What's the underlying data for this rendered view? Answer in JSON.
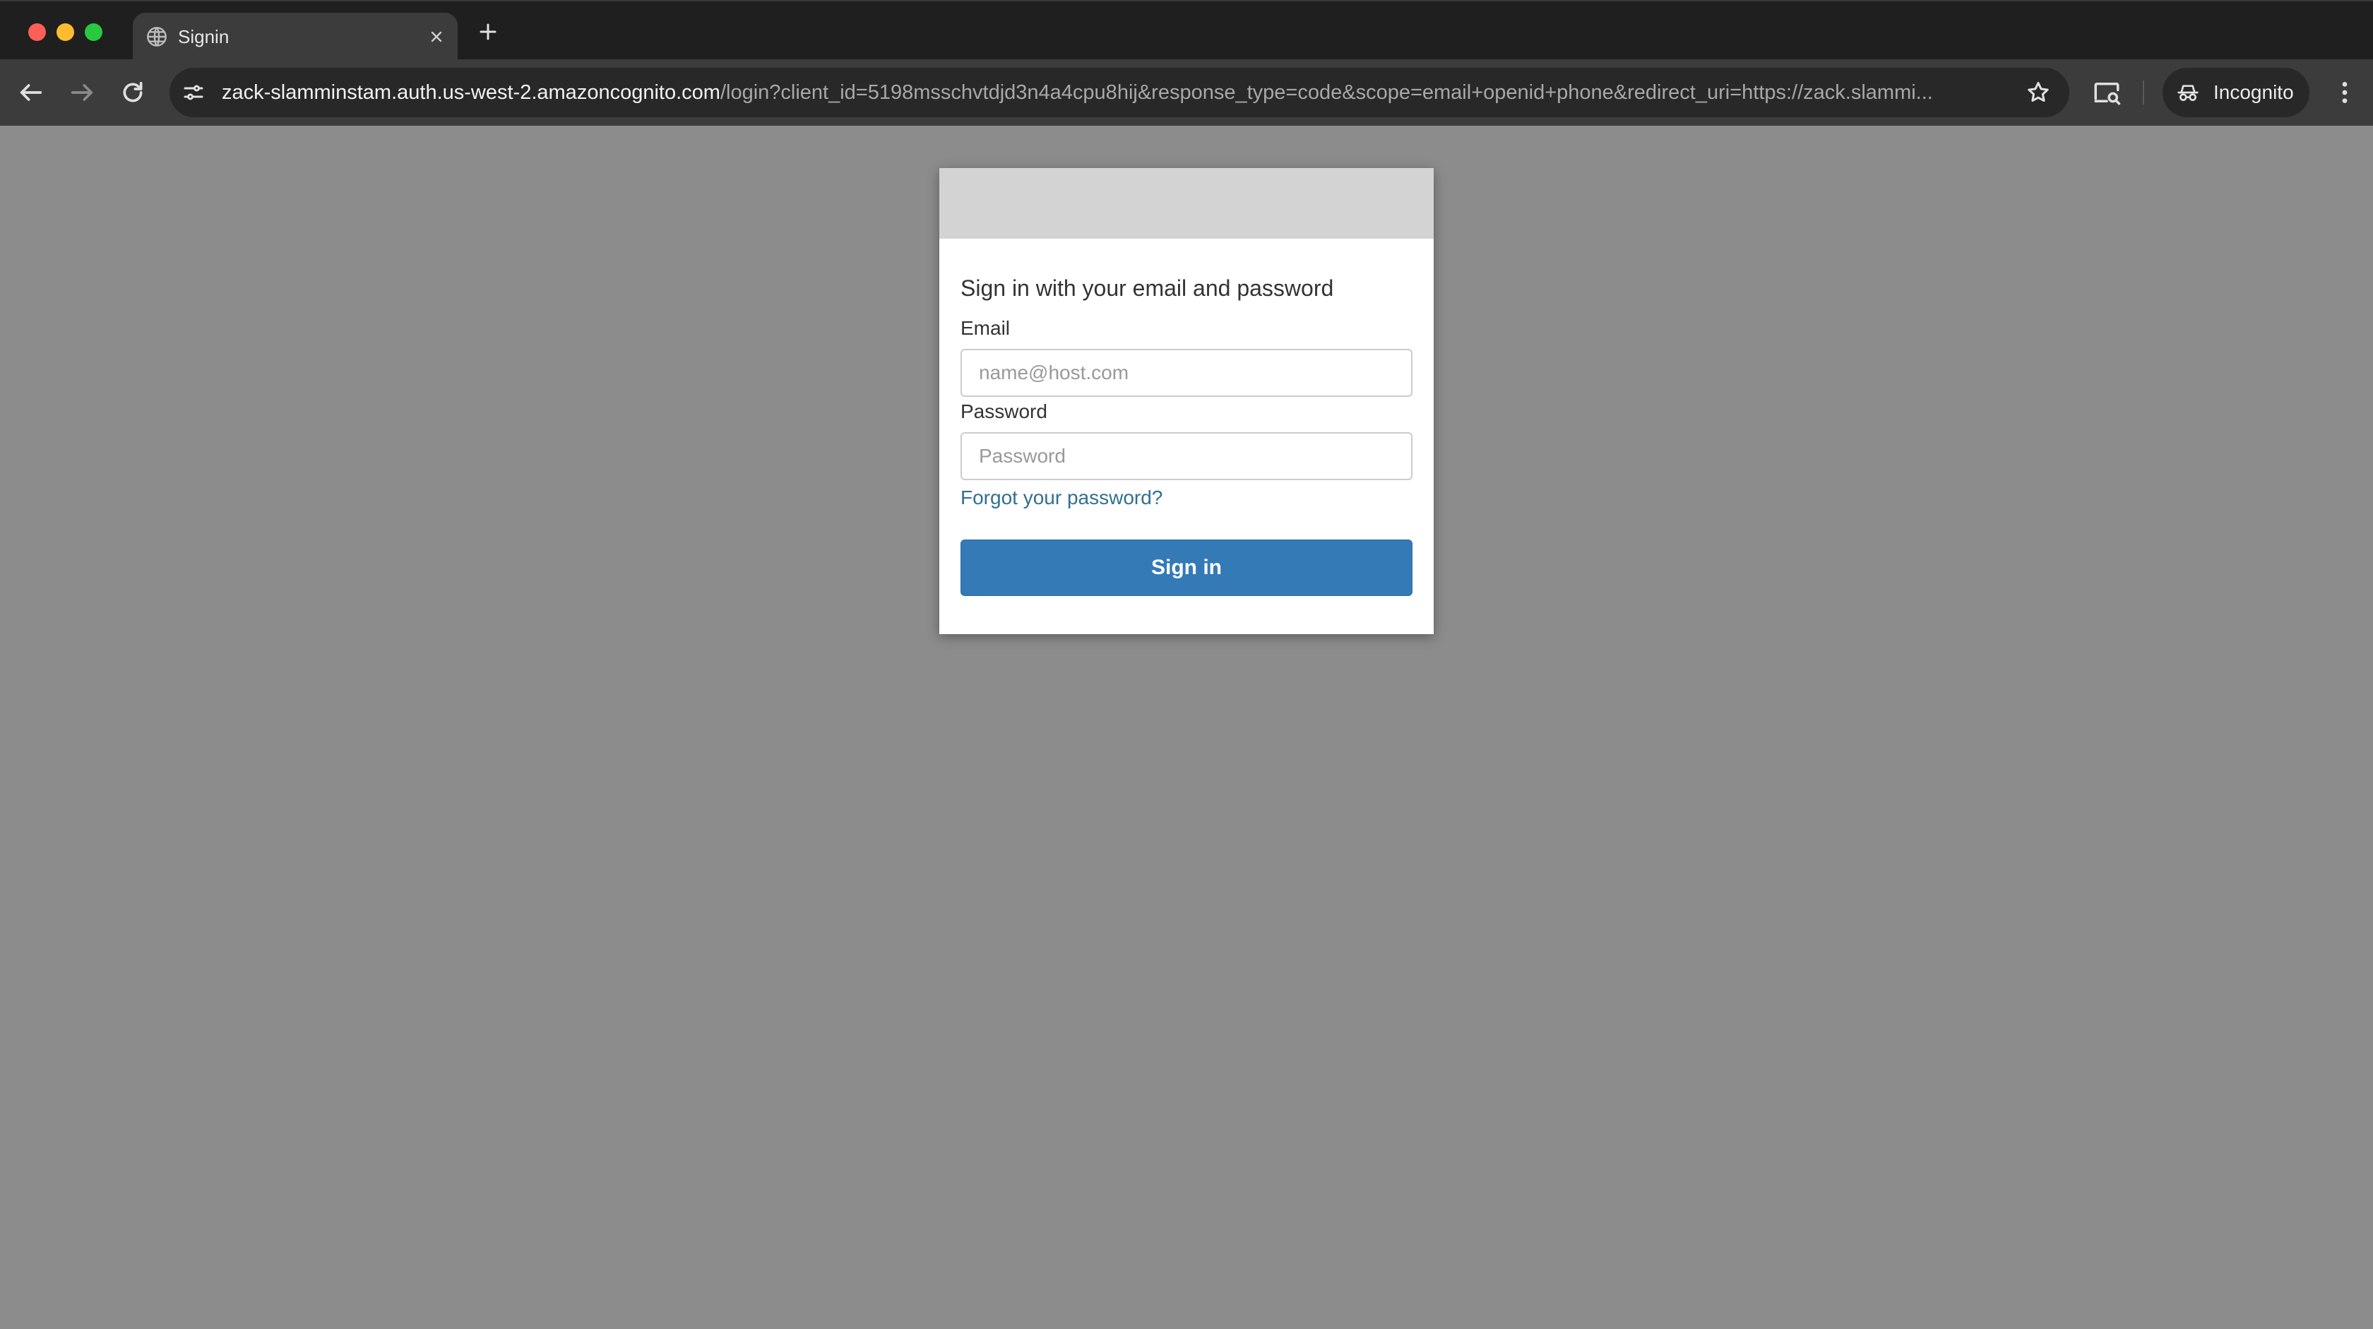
{
  "browser": {
    "tab": {
      "title": "Signin"
    },
    "address_bar": {
      "host": "zack-slamminstam.auth.us-west-2.amazoncognito.com",
      "path": "/login?client_id=5198msschvtdjd3n4a4cpu8hij&response_type=code&scope=email+openid+phone&redirect_uri=https://zack.slammi..."
    },
    "profile": {
      "label": "Incognito"
    },
    "icons": {
      "back": "arrow-left-icon",
      "forward": "arrow-right-icon",
      "reload": "reload-icon",
      "site_info": "tune-icon",
      "bookmark": "star-icon",
      "cast": "cast-icon",
      "incognito": "incognito-icon",
      "menu": "more-vertical-icon"
    }
  },
  "login": {
    "heading": "Sign in with your email and password",
    "email": {
      "label": "Email",
      "placeholder": "name@host.com",
      "value": ""
    },
    "password": {
      "label": "Password",
      "placeholder": "Password",
      "value": ""
    },
    "forgot_link": "Forgot your password?",
    "submit_label": "Sign in"
  },
  "colors": {
    "page_background": "#8c8c8c",
    "banner": "#d3d3d3",
    "button": "#337ab7",
    "link": "#31708f"
  }
}
